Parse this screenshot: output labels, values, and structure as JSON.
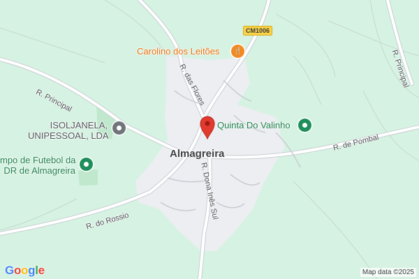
{
  "map": {
    "colors": {
      "land": "#d6f2e2",
      "settlement": "#eef0f2",
      "park": "#b8e6c8",
      "road": "#ffffff",
      "road_edge": "#c9ced3",
      "marker": "#e23a2e",
      "poi_green": "#1e8e5a",
      "poi_grey": "#6f757b",
      "poi_orange": "#f28a21"
    },
    "town_name": "Almagreira",
    "route_badge": "CM1006",
    "roads": {
      "principal_west": "R. Principal",
      "principal_east": "R. Principal",
      "flores": "R. das Flores",
      "dona_ines": "R. Dona Inês Sul",
      "pombal": "R. de Pombal",
      "rossio": "R. do Rossio"
    },
    "pois": [
      {
        "name": "Carolino dos Leitões",
        "icon": "restaurant-icon",
        "category": "restaurant"
      },
      {
        "name": "Quinta Do Valinho",
        "icon": "place-icon",
        "category": "park"
      },
      {
        "name": "ISOLJANELA, UNIPESSOAL, LDA",
        "line1": "ISOLJANELA,",
        "line2": "UNIPESSOAL, LDA",
        "icon": "business-icon",
        "category": "business"
      },
      {
        "name": "mpo de Futebol da DR de Almagreira",
        "line1": "mpo de Futebol da",
        "line2": "DR de Almagreira",
        "icon": "place-icon",
        "category": "sports"
      }
    ],
    "marker_icon": "location-pin-icon",
    "logo": [
      "G",
      "o",
      "o",
      "g",
      "l",
      "e"
    ],
    "attribution": "Map data ©2025"
  }
}
